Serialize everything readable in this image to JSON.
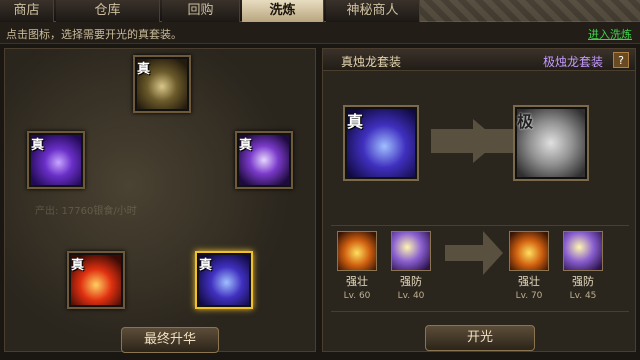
{
  "tabs": [
    {
      "label": "商店"
    },
    {
      "label": "仓库"
    },
    {
      "label": "回购"
    },
    {
      "label": "洗炼"
    },
    {
      "label": "神秘商人"
    }
  ],
  "hint_text": "点击图标，选择需要开光的真套装。",
  "enter_link": "进入洗炼",
  "left_panel": {
    "slots": [
      {
        "badge": "真",
        "art": "gold-beast"
      },
      {
        "badge": "真",
        "art": "purple-lion"
      },
      {
        "badge": "真",
        "art": "tiger"
      },
      {
        "badge": "真",
        "art": "phoenix"
      },
      {
        "badge": "真",
        "art": "dragon",
        "selected": true
      }
    ],
    "faded_text_1": "产出: 17760银食/小时",
    "final_button": "最终升华"
  },
  "right_panel": {
    "current_set": "真烛龙套装",
    "target_set": "极烛龙套装",
    "help_button": "?",
    "current_badge": "真",
    "target_badge": "极",
    "skills_current": [
      {
        "name": "强壮",
        "level": "Lv. 60",
        "icon": "fist"
      },
      {
        "name": "强防",
        "level": "Lv. 40",
        "icon": "shield"
      }
    ],
    "skills_target": [
      {
        "name": "强壮",
        "level": "Lv. 70",
        "icon": "fist"
      },
      {
        "name": "强防",
        "level": "Lv. 45",
        "icon": "shield"
      }
    ],
    "open_button": "开光"
  },
  "colors": {
    "accent_gold": "#f0c030",
    "link_green": "#40d24a",
    "target_purple": "#c69cff"
  }
}
